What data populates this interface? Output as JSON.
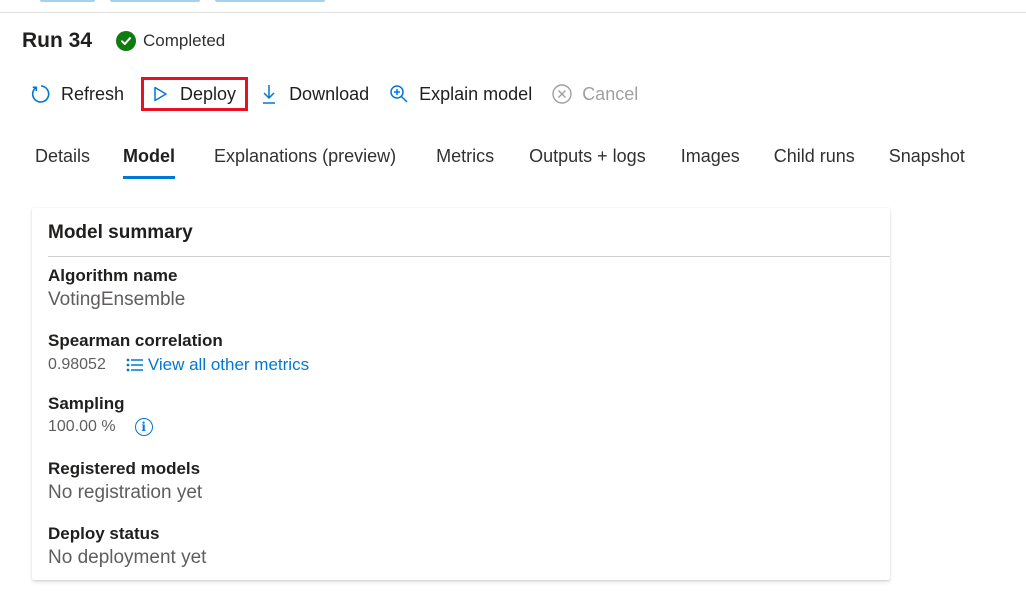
{
  "run": {
    "title": "Run 34",
    "status": "Completed"
  },
  "toolbar": {
    "refresh": "Refresh",
    "deploy": "Deploy",
    "download": "Download",
    "explain": "Explain model",
    "cancel": "Cancel"
  },
  "tabs": [
    "Details",
    "Model",
    "Explanations (preview)",
    "Metrics",
    "Outputs + logs",
    "Images",
    "Child runs",
    "Snapshot"
  ],
  "active_tab": "Model",
  "summary": {
    "title": "Model summary",
    "algorithm": {
      "label": "Algorithm name",
      "value": "VotingEnsemble"
    },
    "spearman": {
      "label": "Spearman correlation",
      "value": "0.98052",
      "link": "View all other metrics"
    },
    "sampling": {
      "label": "Sampling",
      "value": "100.00 %"
    },
    "registered": {
      "label": "Registered models",
      "value": "No registration yet"
    },
    "deploy_status": {
      "label": "Deploy status",
      "value": "No deployment yet"
    }
  },
  "colors": {
    "accent": "#0078d4",
    "success": "#107c10",
    "highlight": "#e81123"
  },
  "icons": [
    "refresh-icon",
    "deploy-icon",
    "download-icon",
    "explain-icon",
    "cancel-icon",
    "check-circle-icon",
    "list-icon",
    "info-icon"
  ]
}
